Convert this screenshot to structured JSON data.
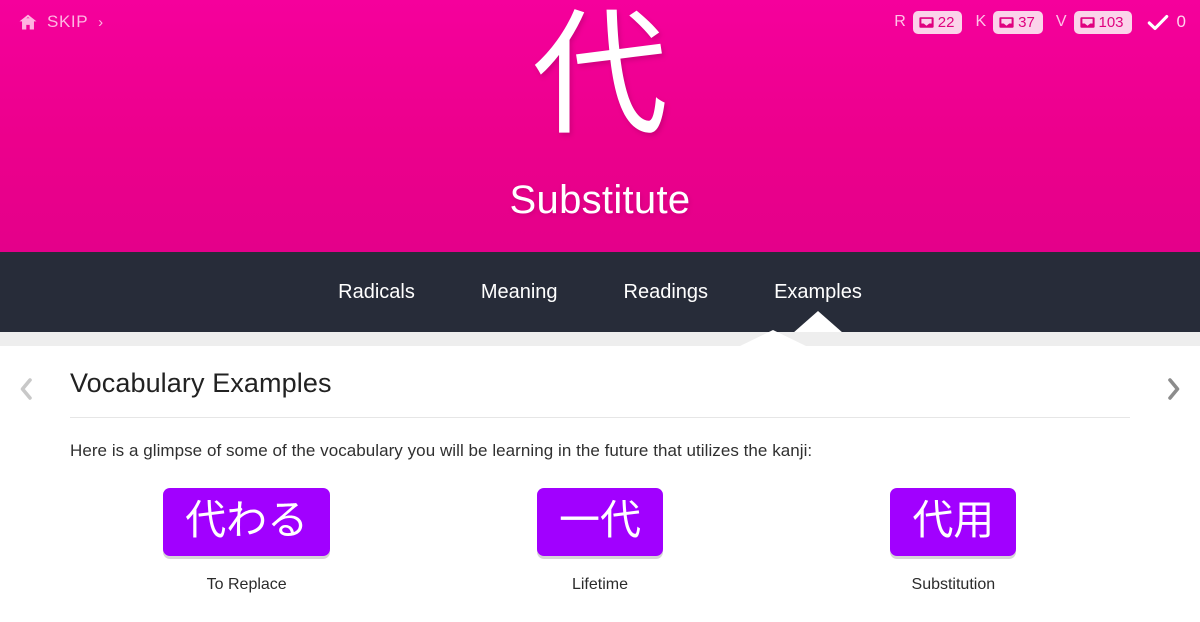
{
  "header": {
    "skip_label": "SKIP",
    "skip_chevron": "›",
    "home_icon": "home-icon",
    "kanji": "代",
    "meaning": "Substitute",
    "background_color": "#ec008c",
    "counters": [
      {
        "letter": "R",
        "icon": "tray-icon",
        "count": "22"
      },
      {
        "letter": "K",
        "icon": "tray-icon",
        "count": "37"
      },
      {
        "letter": "V",
        "icon": "tray-icon",
        "count": "103"
      }
    ],
    "check": {
      "icon": "checkmark-icon",
      "count": "0"
    }
  },
  "nav": {
    "background_color": "#272c39",
    "tabs": [
      {
        "label": "Radicals",
        "active": false
      },
      {
        "label": "Meaning",
        "active": false
      },
      {
        "label": "Readings",
        "active": false
      },
      {
        "label": "Examples",
        "active": true
      }
    ]
  },
  "content": {
    "prev_arrow": "chevron-left-icon",
    "next_arrow": "chevron-right-icon",
    "title": "Vocabulary Examples",
    "intro": "Here is a glimpse of some of the vocabulary you will be learning in the future that utilizes the kanji:",
    "chip_color": "#a100ff",
    "vocabulary": [
      {
        "word": "代わる",
        "meaning": "To Replace"
      },
      {
        "word": "一代",
        "meaning": "Lifetime"
      },
      {
        "word": "代用",
        "meaning": "Substitution"
      }
    ]
  }
}
